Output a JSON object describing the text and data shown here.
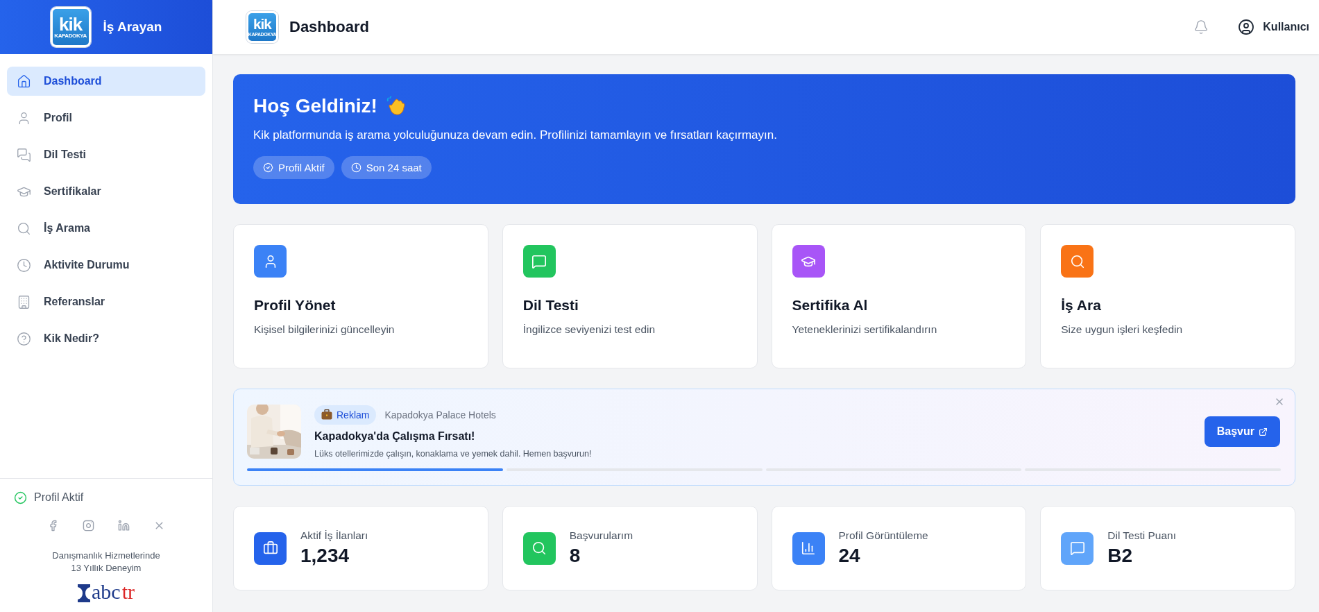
{
  "sidebar": {
    "brand": {
      "logo_text": "kik",
      "logo_subtext": "KAPADOKYA",
      "title": "İş Arayan"
    },
    "nav": [
      {
        "label": "Dashboard",
        "selected": true
      },
      {
        "label": "Profil",
        "selected": false
      },
      {
        "label": "Dil Testi",
        "selected": false
      },
      {
        "label": "Sertifikalar",
        "selected": false
      },
      {
        "label": "İş Arama",
        "selected": false
      },
      {
        "label": "Aktivite Durumu",
        "selected": false
      },
      {
        "label": "Referanslar",
        "selected": false
      },
      {
        "label": "Kik Nedir?",
        "selected": false
      }
    ],
    "status": "Profil Aktif",
    "footer_lines": [
      "Danışmanlık Hizmetlerinde",
      "13 Yıllık Deneyim"
    ],
    "footer_logo": {
      "main": "abc",
      "accent": "tr"
    }
  },
  "header": {
    "logo_text": "kik",
    "logo_subtext": "KAPADOKYA",
    "title": "Dashboard",
    "user": "Kullanıcı"
  },
  "welcome": {
    "title": "Hoş Geldiniz!",
    "text": "Kik platformunda iş arama yolculuğunuza devam edin. Profilinizi tamamlayın ve fırsatları kaçırmayın.",
    "chips": [
      "Profil Aktif",
      "Son 24 saat"
    ]
  },
  "features": [
    {
      "title": "Profil Yönet",
      "description": "Kişisel bilgilerinizi güncelleyin",
      "color": "#3b82f6"
    },
    {
      "title": "Dil Testi",
      "description": "İngilizce seviyenizi test edin",
      "color": "#22c55e"
    },
    {
      "title": "Sertifika Al",
      "description": "Yeteneklerinizi sertifikalandırın",
      "color": "#a855f7"
    },
    {
      "title": "İş Ara",
      "description": "Size uygun işleri keşfedin",
      "color": "#f97316"
    }
  ],
  "ad": {
    "badge": "Reklam",
    "sponsor": "Kapadokya Palace Hotels",
    "title": "Kapadokya'da Çalışma Fırsatı!",
    "text": "Lüks otellerimizde çalışın, konaklama ve yemek dahil. Hemen başvurun!",
    "button": "Başvur",
    "slides": [
      {
        "selected": true
      },
      {
        "selected": false
      },
      {
        "selected": false
      },
      {
        "selected": false
      }
    ]
  },
  "stats": [
    {
      "label": "Aktif İş İlanları",
      "value": "1,234",
      "color": "#2563eb"
    },
    {
      "label": "Başvurularım",
      "value": "8",
      "color": "#22c55e"
    },
    {
      "label": "Profil Görüntüleme",
      "value": "24",
      "color": "#3b82f6"
    },
    {
      "label": "Dil Testi Puanı",
      "value": "B2",
      "color": "#60a5fa"
    }
  ]
}
